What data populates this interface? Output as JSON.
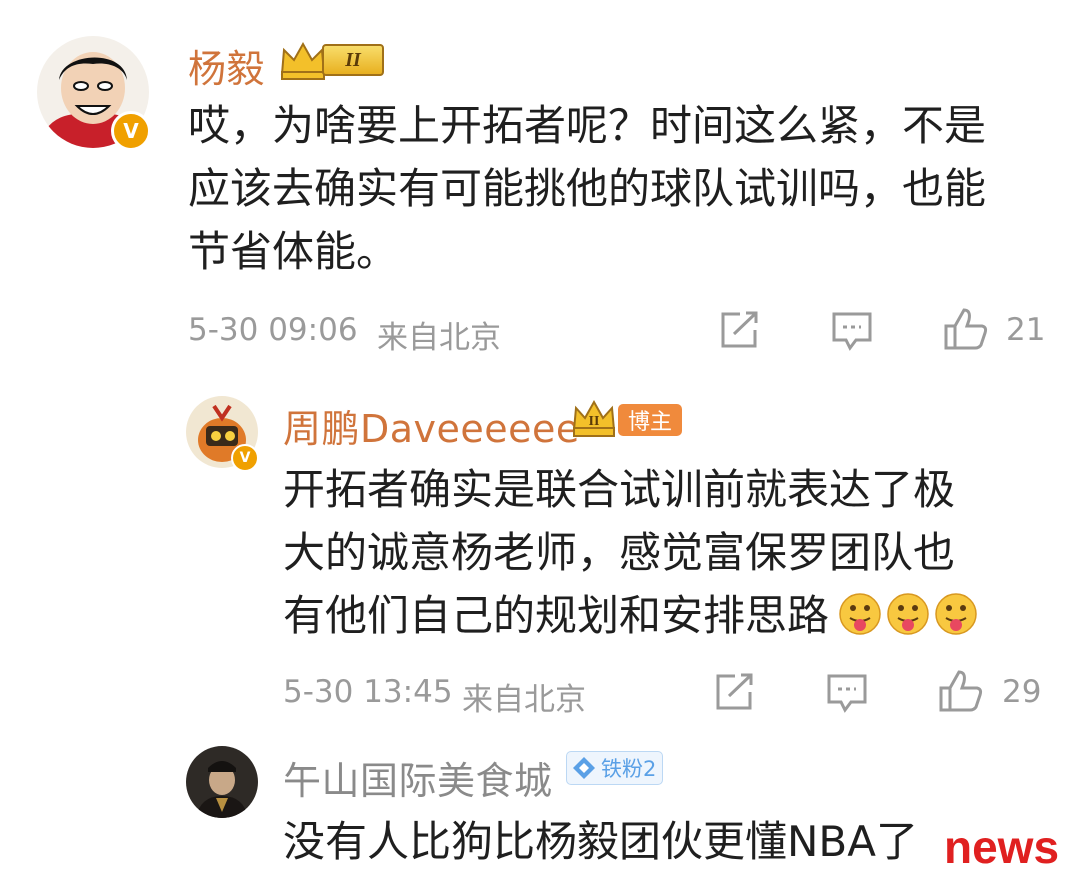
{
  "comments": [
    {
      "username": "杨毅",
      "rank_badge": "II",
      "verified_badge": "V",
      "avatar": "cartoon-avatar-icon",
      "lines": [
        "哎，为啥要上开拓者呢？时间这么紧，不是",
        "应该去确实有可能挑他的球队试训吗，也能",
        "节省体能。"
      ],
      "time": "5-30 09:06",
      "location": "来自北京",
      "likes": "21"
    },
    {
      "username": "周鹏Daveeeeee",
      "rank_badge": "II",
      "role_badge": "博主",
      "verified_badge": "V",
      "avatar": "mascot-avatar-icon",
      "lines": [
        "开拓者确实是联合试训前就表达了极",
        "大的诚意杨老师，感觉富保罗团队也",
        "有他们自己的规划和安排思路"
      ],
      "emojis": [
        "tongue-out-emoji",
        "tongue-out-emoji",
        "tongue-out-emoji"
      ],
      "time": "5-30 13:45",
      "location": "来自北京",
      "likes": "29"
    },
    {
      "username": "午山国际美食城",
      "fan_badge": "铁粉2",
      "avatar": "person-avatar-icon",
      "lines": [
        "没有人比狗比杨毅团伙更懂NBA了"
      ]
    }
  ],
  "watermark": "news",
  "colors": {
    "username": "#d0743b",
    "meta": "#9a9a9a",
    "verified": "#f0a000",
    "role_badge": "#f08a3c",
    "fan_badge": "#5aa0e6",
    "watermark": "#e02020"
  },
  "icons": [
    "share-icon",
    "comment-icon",
    "like-icon"
  ]
}
